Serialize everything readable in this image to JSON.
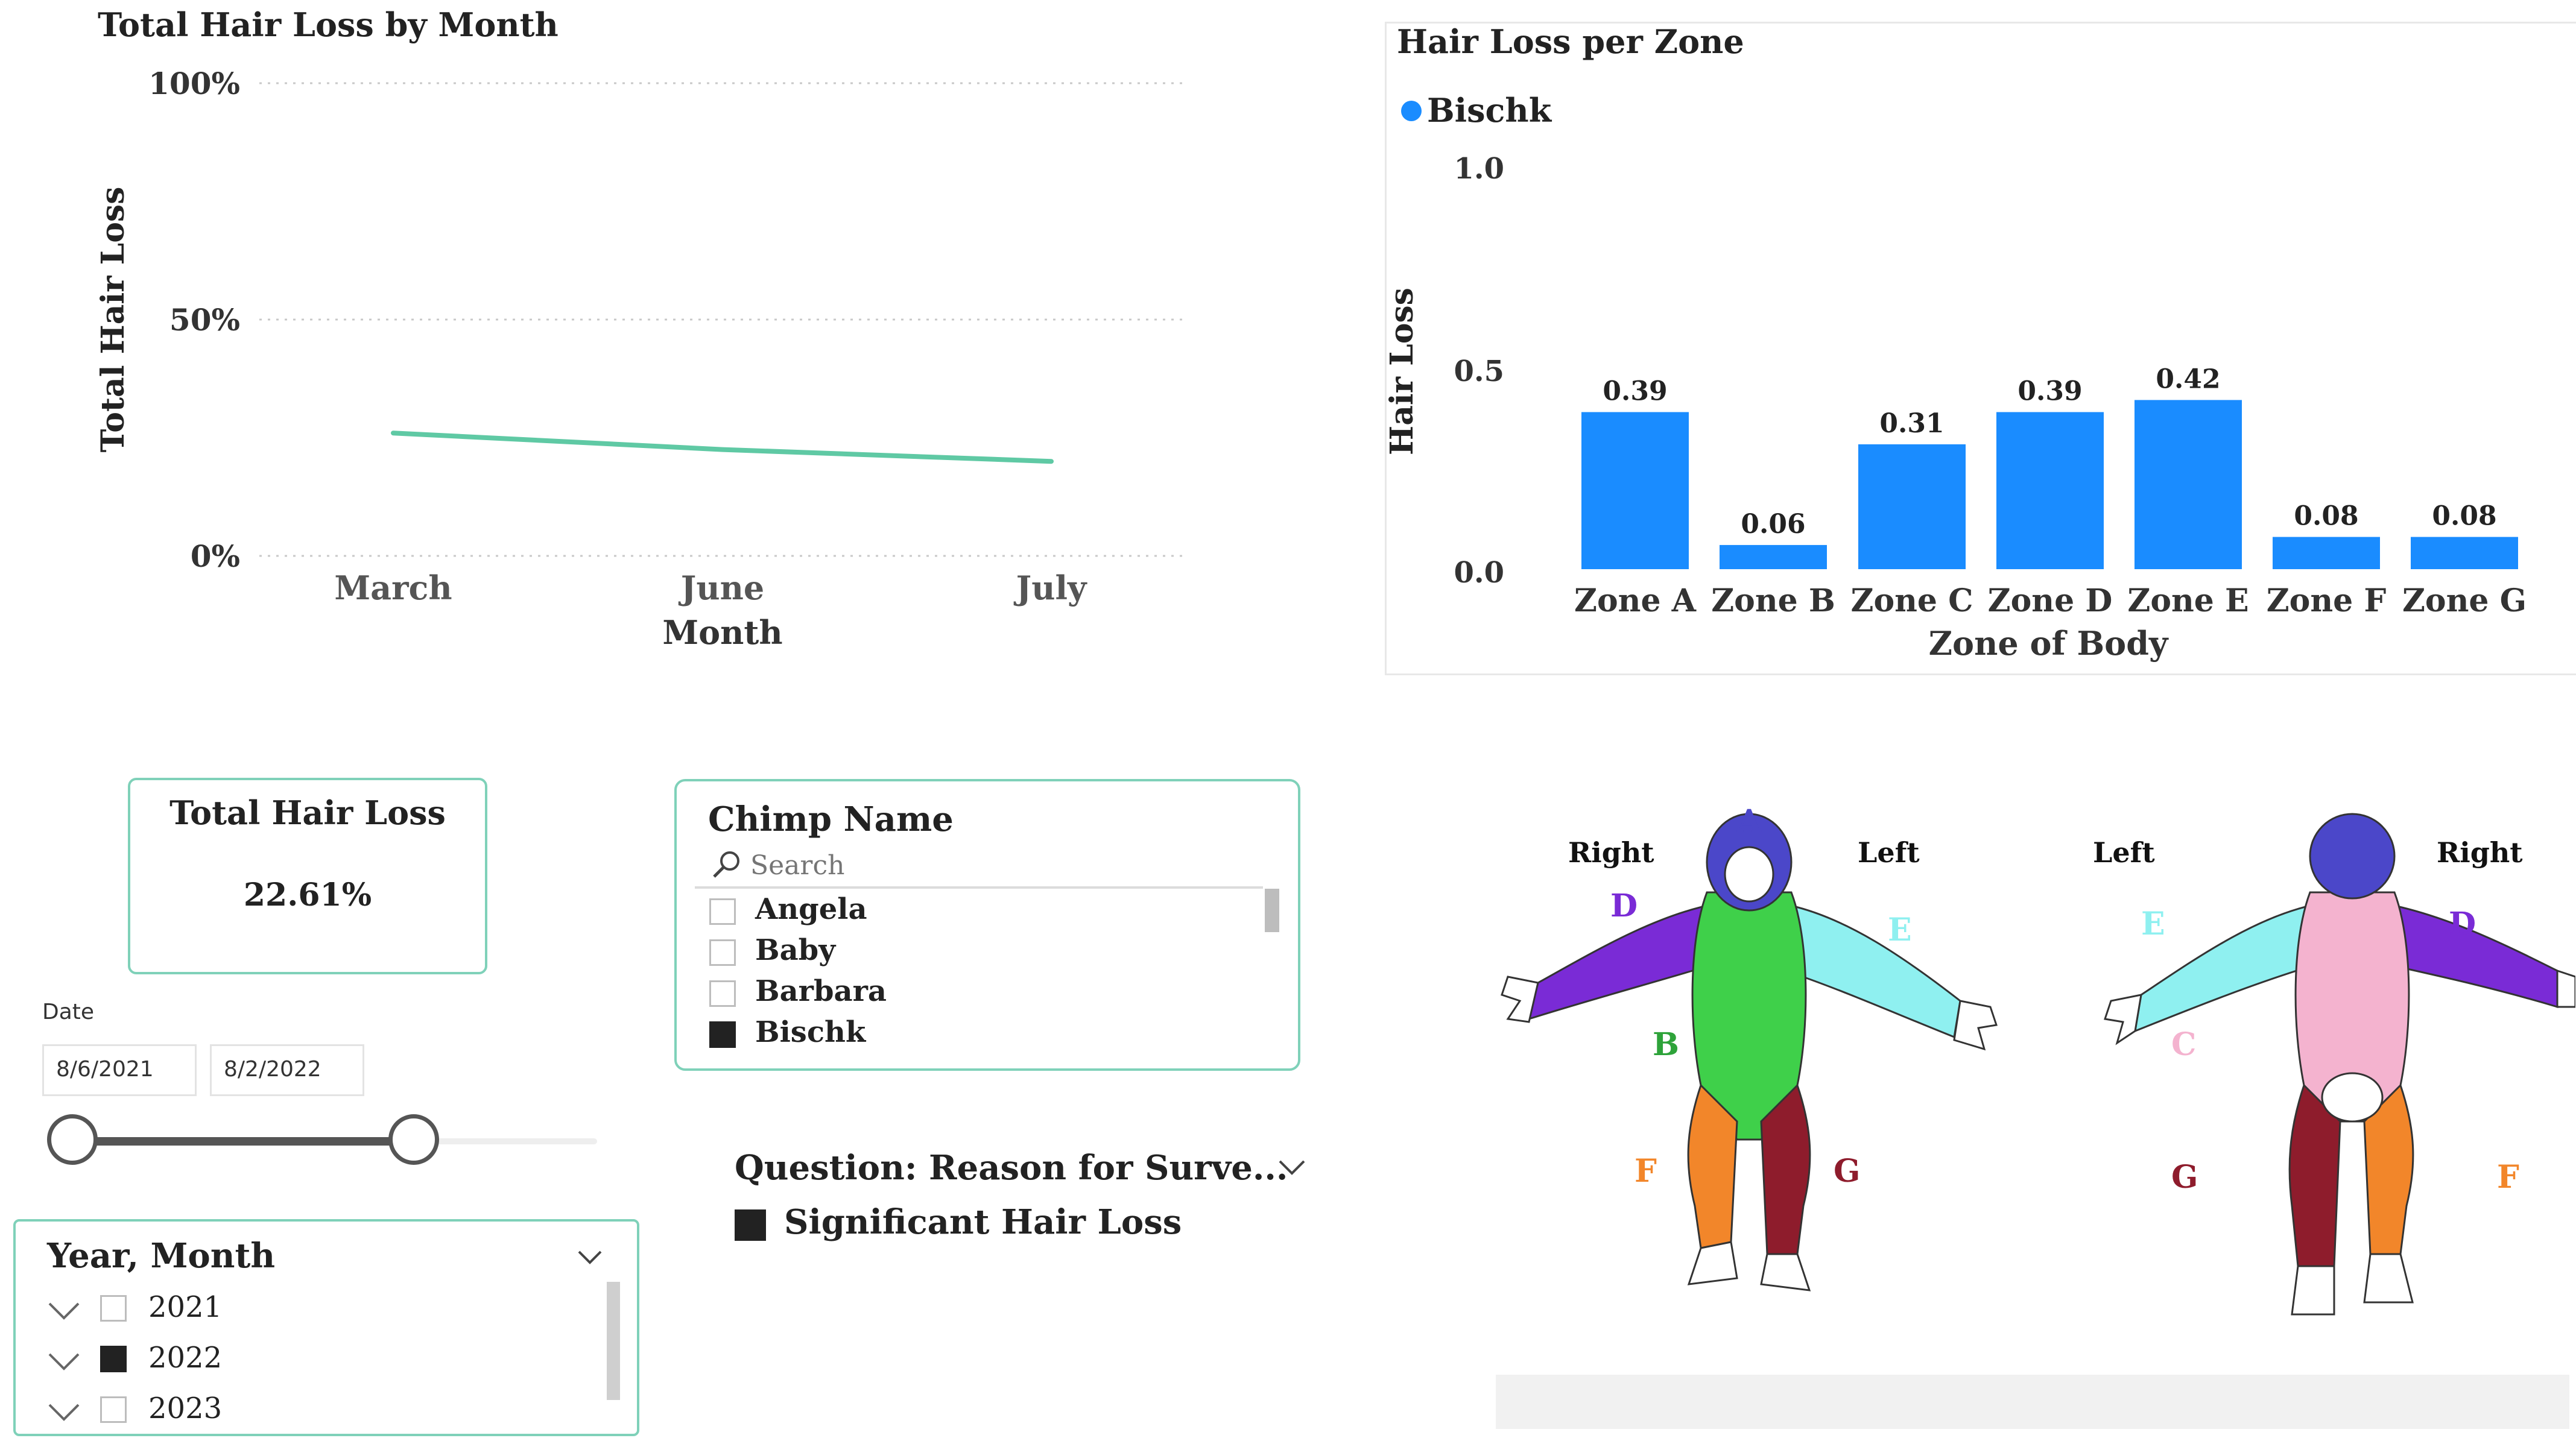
{
  "line_chart": {
    "title": "Total Hair Loss by Month",
    "ylabel": "Total Hair Loss",
    "xlabel": "Month",
    "y_ticks": [
      "100%",
      "50%",
      "0%"
    ],
    "x_ticks": [
      "March",
      "June",
      "July"
    ]
  },
  "bar_chart": {
    "title": "Hair Loss per Zone",
    "legend_label": "Bischk",
    "ylabel": "Hair Loss",
    "xlabel": "Zone of Body",
    "y_ticks": [
      "1.0",
      "0.5",
      "0.0"
    ]
  },
  "chart_data": [
    {
      "type": "line",
      "title": "Total Hair Loss by Month",
      "xlabel": "Month",
      "ylabel": "Total Hair Loss",
      "x": [
        "March",
        "June",
        "July"
      ],
      "series": [
        {
          "values": [
            0.26,
            0.225,
            0.2
          ]
        }
      ],
      "ylim": [
        0,
        1
      ],
      "grid": true,
      "color": "#5fc9a4"
    },
    {
      "type": "bar",
      "title": "Hair Loss per Zone",
      "xlabel": "Zone of Body",
      "ylabel": "Hair Loss",
      "categories": [
        "Zone A",
        "Zone B",
        "Zone C",
        "Zone D",
        "Zone E",
        "Zone F",
        "Zone G"
      ],
      "series": [
        {
          "name": "Bischk",
          "values": [
            0.39,
            0.06,
            0.31,
            0.39,
            0.42,
            0.08,
            0.08
          ]
        }
      ],
      "value_labels": [
        "0.39",
        "0.06",
        "0.31",
        "0.39",
        "0.42",
        "0.08",
        "0.08"
      ],
      "ylim": [
        0,
        1
      ],
      "legend": "top-left",
      "color": "#1a8cff"
    }
  ],
  "kpi": {
    "label": "Total Hair Loss",
    "value": "22.61%"
  },
  "date_slicer": {
    "label": "Date",
    "start": "8/6/2021",
    "end": "8/2/2022",
    "range_start": 0.0,
    "range_end": 0.65
  },
  "year_month": {
    "title": "Year, Month",
    "items": [
      {
        "label": "2021",
        "checked": false
      },
      {
        "label": "2022",
        "checked": true
      },
      {
        "label": "2023",
        "checked": false
      }
    ]
  },
  "chimp_name": {
    "title": "Chimp Name",
    "search_placeholder": "Search",
    "items": [
      {
        "label": "Angela",
        "checked": false
      },
      {
        "label": "Baby",
        "checked": false
      },
      {
        "label": "Barbara",
        "checked": false
      },
      {
        "label": "Bischk",
        "checked": true
      }
    ]
  },
  "question": {
    "title": "Question: Reason for Surve...",
    "item": "Significant Hair Loss"
  },
  "body_map": {
    "front": {
      "right": "Right",
      "left": "Left",
      "A": "A",
      "B": "B",
      "D": "D",
      "E": "E",
      "F": "F",
      "G": "G"
    },
    "back": {
      "left": "Left",
      "right": "Right",
      "C": "C",
      "D": "D",
      "E": "E",
      "F": "F",
      "G": "G"
    },
    "zone_colors": {
      "A": "#4b47c9",
      "B": "#3fd04a",
      "C": "#f4b3cf",
      "D": "#7a2bd6",
      "E": "#8ff0f0",
      "F": "#f2862a",
      "G": "#8e1c2c"
    }
  }
}
